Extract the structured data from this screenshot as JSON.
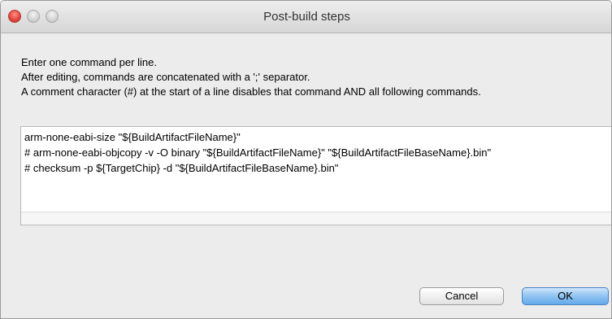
{
  "window": {
    "title": "Post-build steps"
  },
  "instructions": [
    "Enter one command per line.",
    "After editing, commands are concatenated with a ';' separator.",
    "A comment character (#) at the start of a line disables that command AND all following commands."
  ],
  "commands": [
    "arm-none-eabi-size \"${BuildArtifactFileName}\"",
    "# arm-none-eabi-objcopy -v -O binary \"${BuildArtifactFileName}\" \"${BuildArtifactFileBaseName}.bin\"",
    "# checksum -p ${TargetChip} -d \"${BuildArtifactFileBaseName}.bin\""
  ],
  "buttons": {
    "cancel": "Cancel",
    "ok": "OK"
  },
  "colors": {
    "close": "#e0443e",
    "ok_button": "#64a9ea"
  }
}
